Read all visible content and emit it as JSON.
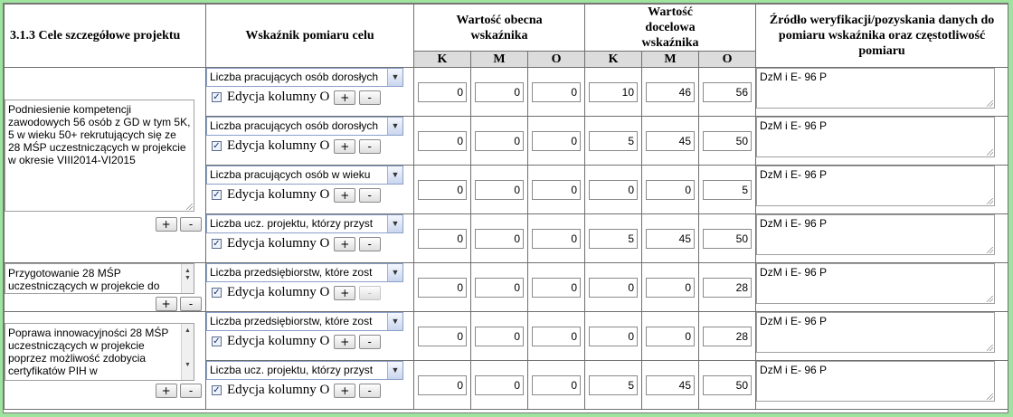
{
  "headers": {
    "goals": "3.1.3 Cele szczegółowe projektu",
    "indicator": "Wskaźnik pomiaru celu",
    "current": "Wartość obecna wskaźnika",
    "target": "Wartość docelowa wskaźnika",
    "source": "Źródło weryfikacji/pozyskania danych do pomiaru wskaźnika oraz częstotliwość pomiaru",
    "k": "K",
    "m": "M",
    "o": "O"
  },
  "plus_label": "+",
  "minus_label": "-",
  "edit_label": "Edycja kolumny O",
  "checkbox_mark": "✓",
  "goals": [
    {
      "text": "Podniesienie kompetencji zawodowych 56 osób z GD w tym 5K, 5 w wieku 50+ rekrutujących się ze 28 MŚP uczestniczących w projekcie  w okresie VIII2014-VI2015"
    },
    {
      "text": "Przygotowanie 28 MŚP uczestniczących w projekcie do"
    },
    {
      "text": "Poprawa innowacyjności 28 MŚP uczestniczących w projekcie poprzez możliwość zdobycia certyfikatów PIH w"
    }
  ],
  "rows": [
    {
      "indicator": "Liczba pracujących osób dorosłych",
      "cur_k": "0",
      "cur_m": "0",
      "cur_o": "0",
      "tgt_k": "10",
      "tgt_m": "46",
      "tgt_o": "56",
      "source": "DzM i E- 96 P"
    },
    {
      "indicator": "Liczba pracujących osób dorosłych",
      "cur_k": "0",
      "cur_m": "0",
      "cur_o": "0",
      "tgt_k": "5",
      "tgt_m": "45",
      "tgt_o": "50",
      "source": "DzM i E- 96 P"
    },
    {
      "indicator": "Liczba pracujących osób w wieku",
      "cur_k": "0",
      "cur_m": "0",
      "cur_o": "0",
      "tgt_k": "0",
      "tgt_m": "0",
      "tgt_o": "5",
      "source": "DzM i E- 96 P"
    },
    {
      "indicator": "Liczba ucz. projektu, którzy przyst",
      "cur_k": "0",
      "cur_m": "0",
      "cur_o": "0",
      "tgt_k": "5",
      "tgt_m": "45",
      "tgt_o": "50",
      "source": "DzM i E- 96 P"
    },
    {
      "indicator": "Liczba przedsiębiorstw, które zost",
      "cur_k": "0",
      "cur_m": "0",
      "cur_o": "0",
      "tgt_k": "0",
      "tgt_m": "0",
      "tgt_o": "28",
      "source": "DzM i E- 96 P"
    },
    {
      "indicator": "Liczba przedsiębiorstw, które zost",
      "cur_k": "0",
      "cur_m": "0",
      "cur_o": "0",
      "tgt_k": "0",
      "tgt_m": "0",
      "tgt_o": "28",
      "source": "DzM i E- 96 P"
    },
    {
      "indicator": "Liczba ucz. projektu, którzy przyst",
      "cur_k": "0",
      "cur_m": "0",
      "cur_o": "0",
      "tgt_k": "5",
      "tgt_m": "45",
      "tgt_o": "50",
      "source": "DzM i E- 96 P"
    }
  ]
}
